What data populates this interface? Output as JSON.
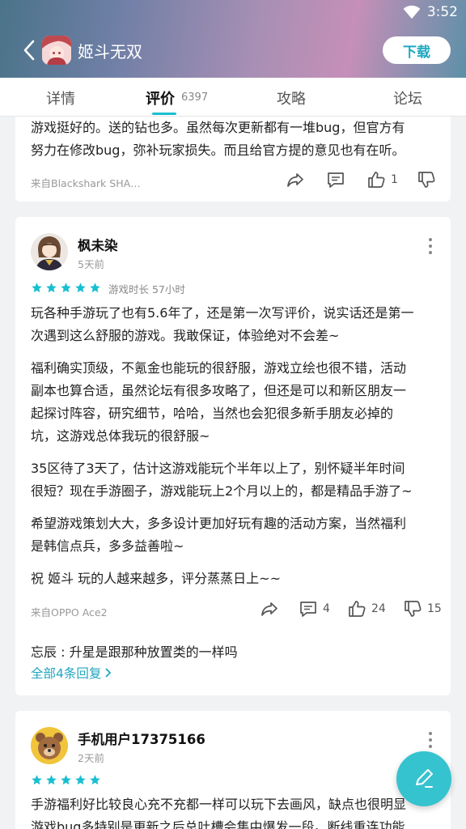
{
  "status_bar": {
    "time": "3:52"
  },
  "header": {
    "app_title": "姬斗无双",
    "download_label": "下载"
  },
  "tabs": [
    {
      "label": "详情"
    },
    {
      "label": "评价",
      "count": "6397"
    },
    {
      "label": "攻略"
    },
    {
      "label": "论坛"
    }
  ],
  "review_prev": {
    "text_lines": [
      "游戏挺好的。送的钻也多。虽然每次更新都有一堆bug，但官方有",
      "努力在修改bug，弥补玩家损失。而且给官方提的意见也有在听。"
    ],
    "device": "来自Blackshark SHA…",
    "likes": "1"
  },
  "review_main": {
    "username": "枫未染",
    "time_ago": "5天前",
    "rating": 5,
    "playtime": "游戏时长 57小时",
    "paragraphs": [
      [
        "玩各种手游玩了也有5.6年了，还是第一次写评价，说实话还是第一",
        "次遇到这么舒服的游戏。我敢保证，体验绝对不会差~"
      ],
      [
        "福利确实顶级，不氪金也能玩的很舒服，游戏立绘也很不错，活动",
        "副本也算合适，虽然论坛有很多攻略了，但还是可以和新区朋友一",
        "起探讨阵容，研究细节，哈哈，当然也会犯很多新手朋友必掉的",
        "坑，这游戏总体我玩的很舒服~"
      ],
      [
        "35区待了3天了，估计这游戏能玩个半年以上了，别怀疑半年时间",
        "很短？现在手游圈子，游戏能玩上2个月以上的，都是精品手游了~"
      ],
      [
        "希望游戏策划大大，多多设计更加好玩有趣的活动方案，当然福利",
        "是韩信点兵，多多益善啦~"
      ],
      [
        "祝 姬斗 玩的人越来越多，评分蒸蒸日上~~"
      ]
    ],
    "device": "来自OPPO Ace2",
    "comments": "4",
    "likes": "24",
    "dislikes": "15",
    "reply_preview": {
      "author": "忘辰",
      "text": "升星是跟那种放置类的一样吗"
    },
    "all_replies_label": "全部4条回复"
  },
  "review_next": {
    "username": "手机用户17375166",
    "time_ago": "2天前",
    "rating": 5,
    "text_lines": [
      "手游福利好比较良心充不充都一样可以玩下去画风，缺点也很明显",
      "游戏bug多特别是更新之后总吐槽会集中爆发一段。断线重连功能"
    ]
  },
  "colors": {
    "accent": "#19bfd1",
    "link": "#21a6bf",
    "fab": "#35c3cf"
  },
  "icons": [
    "back-arrow-icon",
    "wifi-icon",
    "share-icon",
    "comment-icon",
    "thumbs-up-icon",
    "thumbs-down-icon",
    "more-vertical-icon",
    "star-icon",
    "chevron-right-icon",
    "edit-pen-icon"
  ]
}
